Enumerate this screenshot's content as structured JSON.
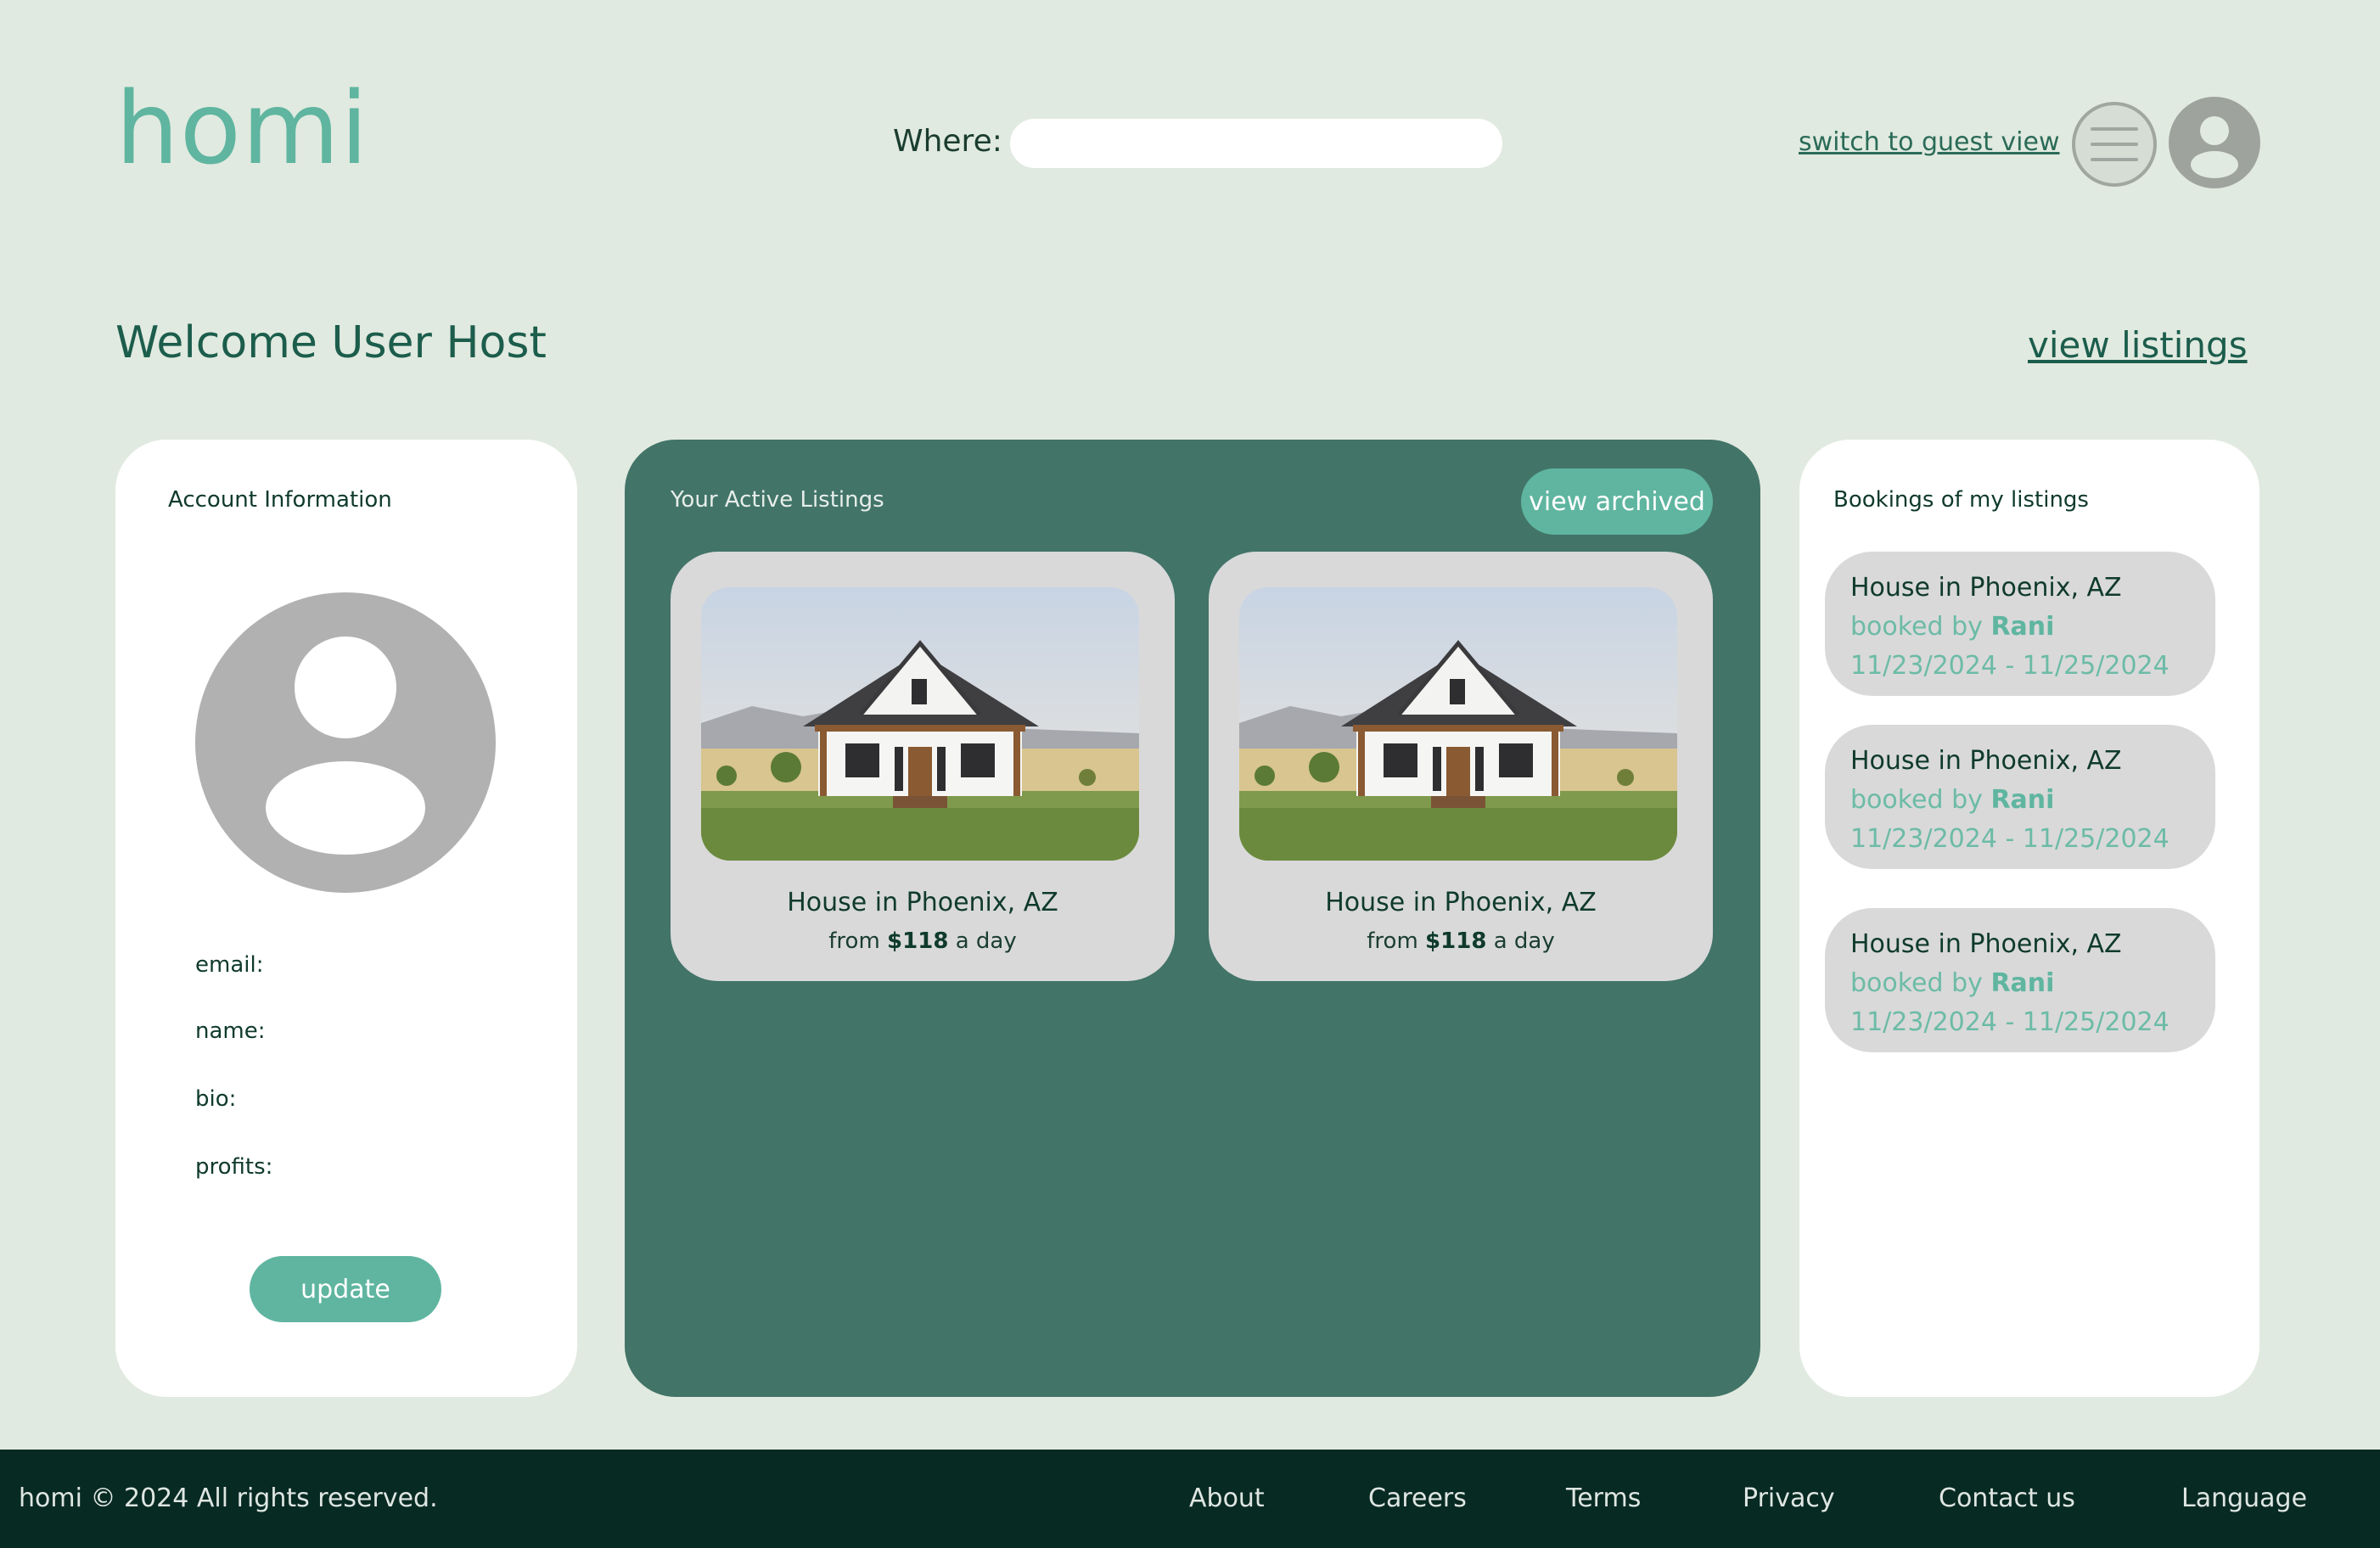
{
  "header": {
    "logo": "homi",
    "search_label": "Where:",
    "search_value": "",
    "guest_view_link": "switch to guest view",
    "menu_icon": "hamburger-menu-icon",
    "avatar_icon": "user-avatar-icon"
  },
  "welcome": {
    "title": "Welcome User Host",
    "view_listings_link": "view listings"
  },
  "account": {
    "title": "Account Information",
    "avatar_icon": "user-avatar-icon",
    "fields": {
      "email": "email:",
      "name": "name:",
      "bio": "bio:",
      "profits": "profits:"
    },
    "update_button": "update"
  },
  "active_listings": {
    "title": "Your Active Listings",
    "view_archived_button": "view archived",
    "items": [
      {
        "name": "House in Phoenix, AZ",
        "price_prefix": "from",
        "price": "$118",
        "price_suffix": "a day"
      },
      {
        "name": "House in Phoenix, AZ",
        "price_prefix": "from",
        "price": "$118",
        "price_suffix": "a day"
      }
    ]
  },
  "bookings": {
    "title": "Bookings of my listings",
    "items": [
      {
        "listing": "House in Phoenix, AZ",
        "booked_by_label": "booked by",
        "guest": "Rani",
        "dates": "11/23/2024 - 11/25/2024"
      },
      {
        "listing": "House in Phoenix, AZ",
        "booked_by_label": "booked by",
        "guest": "Rani",
        "dates": "11/23/2024 - 11/25/2024"
      },
      {
        "listing": "House in Phoenix, AZ",
        "booked_by_label": "booked by",
        "guest": "Rani",
        "dates": "11/23/2024 - 11/25/2024"
      }
    ]
  },
  "footer": {
    "copyright": "homi © 2024 All rights reserved.",
    "links": [
      "About",
      "Careers",
      "Terms",
      "Privacy",
      "Contact us",
      "Language"
    ]
  },
  "colors": {
    "background": "#e1eae0",
    "accent": "#5fb5a0",
    "dark_green": "#427468",
    "footer": "#072a22"
  }
}
